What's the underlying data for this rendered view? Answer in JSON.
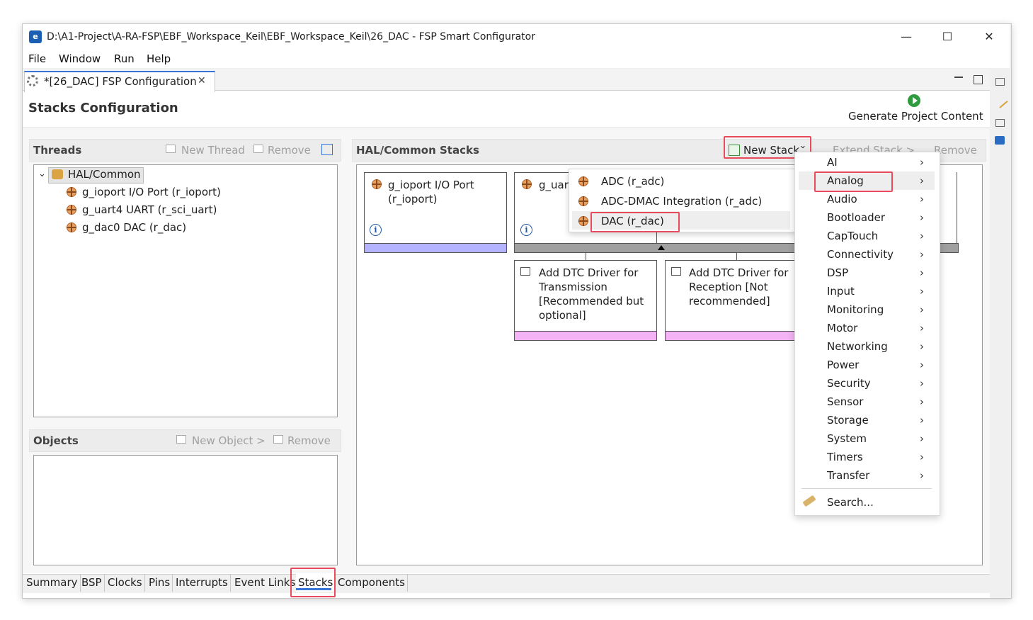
{
  "window": {
    "title": "D:\\A1-Project\\A-RA-FSP\\EBF_Workspace_Keil\\EBF_Workspace_Keil\\26_DAC - FSP Smart Configurator",
    "minimize": "—",
    "maximize": "☐",
    "close": "✕"
  },
  "menu": [
    "File",
    "Window",
    "Run",
    "Help"
  ],
  "editor_tab": {
    "label": "*[26_DAC] FSP Configuration",
    "close": "✕"
  },
  "page": {
    "title": "Stacks Configuration",
    "generate_label": "Generate Project Content"
  },
  "threads": {
    "title": "Threads",
    "new_thread": "New Thread",
    "remove": "Remove",
    "root": "HAL/Common",
    "items": [
      "g_ioport I/O Port (r_ioport)",
      "g_uart4 UART (r_sci_uart)",
      "g_dac0 DAC (r_dac)"
    ]
  },
  "objects": {
    "title": "Objects",
    "new_object": "New Object >",
    "remove": "Remove"
  },
  "stacks": {
    "title": "HAL/Common Stacks",
    "new_stack": "New Stack",
    "new_stack_chevron": "›",
    "extend_stack": "Extend Stack >",
    "remove": "Remove",
    "cards": [
      {
        "line1": "g_ioport I/O Port",
        "line2": "(r_ioport)"
      },
      {
        "line1": "g_uar",
        "line2": ""
      }
    ],
    "sub_cards": [
      {
        "lines": [
          "Add DTC Driver for",
          "Transmission",
          "[Recommended but",
          "optional]"
        ]
      },
      {
        "lines": [
          "Add DTC Driver for",
          "Reception [Not",
          "recommended]"
        ]
      }
    ],
    "info_glyph": "i"
  },
  "analog_menu": [
    "ADC (r_adc)",
    "ADC-DMAC Integration (r_adc)",
    "DAC (r_dac)"
  ],
  "category_menu": {
    "items": [
      "AI",
      "Analog",
      "Audio",
      "Bootloader",
      "CapTouch",
      "Connectivity",
      "DSP",
      "Input",
      "Monitoring",
      "Motor",
      "Networking",
      "Power",
      "Security",
      "Sensor",
      "Storage",
      "System",
      "Timers",
      "Transfer"
    ],
    "chevron": "›",
    "search": "Search..."
  },
  "bottom_tabs": [
    "Summary",
    "BSP",
    "Clocks",
    "Pins",
    "Interrupts",
    "Event Links",
    "Stacks",
    "Components"
  ],
  "selected_bottom_tab": "Stacks",
  "colors": {
    "highlight": "#e84c5c",
    "accent": "#3875d7"
  }
}
